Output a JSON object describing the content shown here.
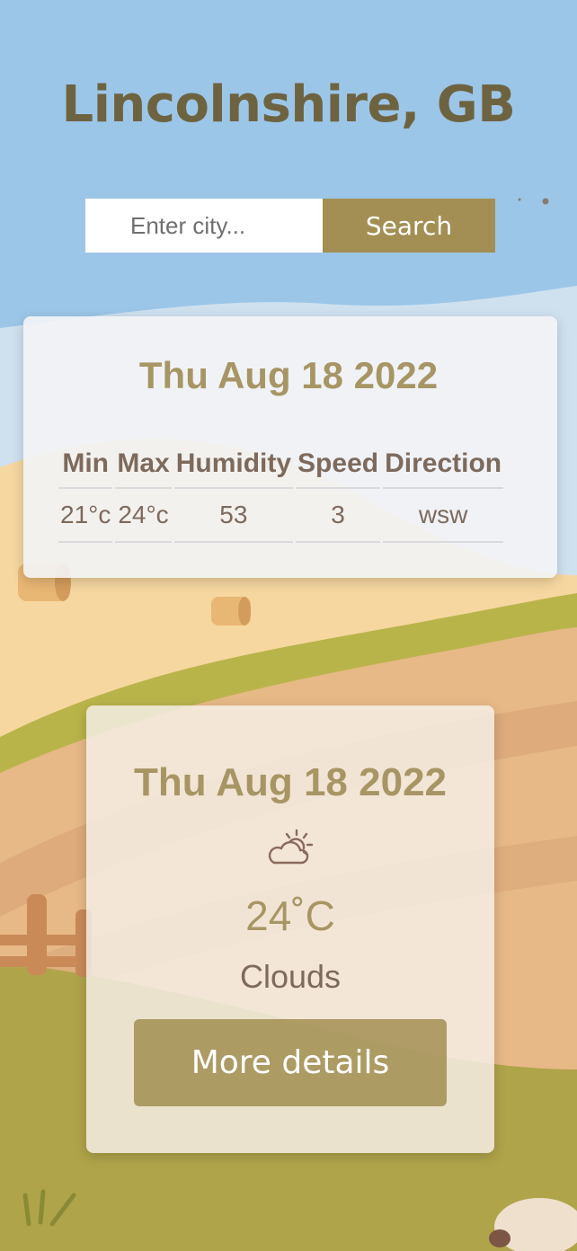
{
  "header": {
    "city": "Lincolnshire, GB"
  },
  "search": {
    "placeholder": "Enter city...",
    "button_label": "Search"
  },
  "summary": {
    "date": "Thu Aug 18 2022",
    "columns": [
      "Min",
      "Max",
      "Humidity",
      "Speed",
      "Direction"
    ],
    "row": [
      "21°c",
      "24°c",
      "53",
      "3",
      "wsw"
    ]
  },
  "today": {
    "date": "Thu Aug 18 2022",
    "icon": "partly-cloudy-icon",
    "temperature": "24˚C",
    "condition": "Clouds",
    "details_label": "More details"
  },
  "colors": {
    "sky": "#9cc6e8",
    "title": "#6e6340",
    "accent": "#a38f53",
    "date_text": "#a79664",
    "body_text": "#7d6a5c"
  }
}
